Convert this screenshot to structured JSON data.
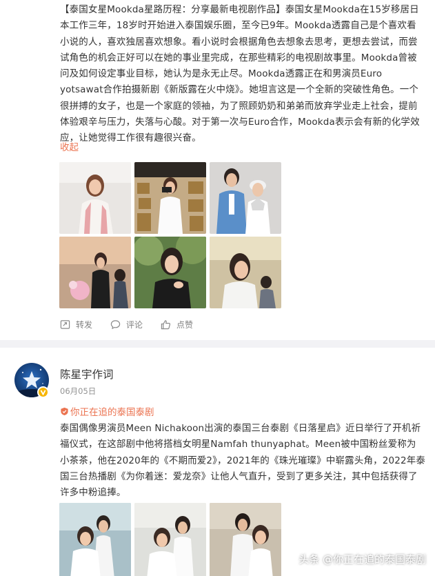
{
  "post1": {
    "text": "【泰国女星Mookda星路历程：分享最新电视剧作品】泰国女星Mookda在15岁移居日本工作三年，18岁时开始进入泰国娱乐圈，至今已9年。Mookda透露自己是个喜欢看小说的人，喜欢独居喜欢想象。看小说时会根据角色去想象去思考，更想去尝试，而尝试角色的机会正好可以在她的事业里完成，在那些精彩的电视剧故事里。Mookda曾被问及如何设定事业目标，她认为是永无止尽。Mookda透露正在和男演员Euro yotsawat合作拍摄新剧《新版露在火中烧》。她坦言这是一个全新的突破性角色。一个很拼搏的女子，也是一个家庭的领袖，为了照顾奶奶和弟弟而放弃学业走上社会，提前体验艰辛与压力，失落与心酸。对于第一次与Euro合作，Mookda表示会有新的化学效应，让她觉得工作很有趣很兴奋。",
    "collapse_label": "收起",
    "actions": {
      "repost": "转发",
      "comment": "评论",
      "like": "点赞"
    }
  },
  "post2": {
    "username": "陈星宇作词",
    "date": "06月05日",
    "topic": "你正在追的泰国泰剧",
    "text": "泰国偶像男演员Meen Nichakoon出演的泰国三台泰剧《日落星启》近日举行了开机祈福仪式，在这部剧中他将搭档女明星Namfah thunyaphat。Meen被中国粉丝爱称为小茶茶，他在2020年的《不期而爱2》，2021年的《珠光璀璨》中崭露头角，2022年泰国三台热播剧《为你着迷：爱龙奈》让他人气直升，受到了更多关注，其中包括获得了许多中粉追捧。"
  },
  "watermark": "头条 @你正在追的泰国泰剧",
  "colors": {
    "accent": "#eb7350",
    "text": "#333333",
    "meta": "#939393",
    "separator": "#f2f2f5"
  }
}
